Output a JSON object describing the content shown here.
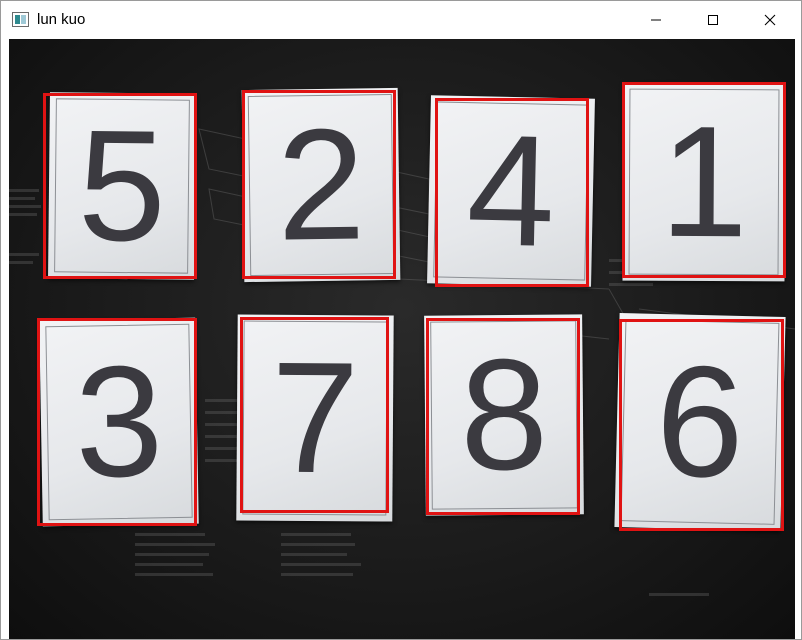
{
  "window": {
    "title": "lun kuo",
    "icon": "window-app-icon",
    "controls": {
      "minimize": "minimize-icon",
      "maximize": "maximize-icon",
      "close": "close-icon"
    }
  },
  "cards": [
    {
      "digit": "5"
    },
    {
      "digit": "2"
    },
    {
      "digit": "4"
    },
    {
      "digit": "1"
    },
    {
      "digit": "3"
    },
    {
      "digit": "7"
    },
    {
      "digit": "8"
    },
    {
      "digit": "6"
    }
  ],
  "colors": {
    "detection_box": "#e01313",
    "card": "#eceef0",
    "digit": "#3b3a40",
    "background": "#1b1b1b"
  }
}
